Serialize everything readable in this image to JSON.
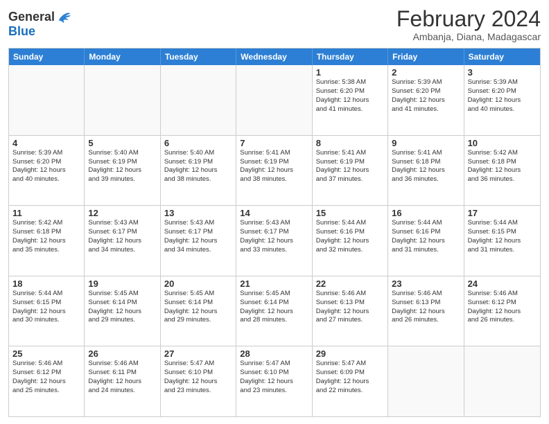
{
  "logo": {
    "general": "General",
    "blue": "Blue"
  },
  "title": {
    "main": "February 2024",
    "sub": "Ambanja, Diana, Madagascar"
  },
  "header_days": [
    "Sunday",
    "Monday",
    "Tuesday",
    "Wednesday",
    "Thursday",
    "Friday",
    "Saturday"
  ],
  "weeks": [
    [
      {
        "day": "",
        "info": ""
      },
      {
        "day": "",
        "info": ""
      },
      {
        "day": "",
        "info": ""
      },
      {
        "day": "",
        "info": ""
      },
      {
        "day": "1",
        "info": "Sunrise: 5:38 AM\nSunset: 6:20 PM\nDaylight: 12 hours\nand 41 minutes."
      },
      {
        "day": "2",
        "info": "Sunrise: 5:39 AM\nSunset: 6:20 PM\nDaylight: 12 hours\nand 41 minutes."
      },
      {
        "day": "3",
        "info": "Sunrise: 5:39 AM\nSunset: 6:20 PM\nDaylight: 12 hours\nand 40 minutes."
      }
    ],
    [
      {
        "day": "4",
        "info": "Sunrise: 5:39 AM\nSunset: 6:20 PM\nDaylight: 12 hours\nand 40 minutes."
      },
      {
        "day": "5",
        "info": "Sunrise: 5:40 AM\nSunset: 6:19 PM\nDaylight: 12 hours\nand 39 minutes."
      },
      {
        "day": "6",
        "info": "Sunrise: 5:40 AM\nSunset: 6:19 PM\nDaylight: 12 hours\nand 38 minutes."
      },
      {
        "day": "7",
        "info": "Sunrise: 5:41 AM\nSunset: 6:19 PM\nDaylight: 12 hours\nand 38 minutes."
      },
      {
        "day": "8",
        "info": "Sunrise: 5:41 AM\nSunset: 6:19 PM\nDaylight: 12 hours\nand 37 minutes."
      },
      {
        "day": "9",
        "info": "Sunrise: 5:41 AM\nSunset: 6:18 PM\nDaylight: 12 hours\nand 36 minutes."
      },
      {
        "day": "10",
        "info": "Sunrise: 5:42 AM\nSunset: 6:18 PM\nDaylight: 12 hours\nand 36 minutes."
      }
    ],
    [
      {
        "day": "11",
        "info": "Sunrise: 5:42 AM\nSunset: 6:18 PM\nDaylight: 12 hours\nand 35 minutes."
      },
      {
        "day": "12",
        "info": "Sunrise: 5:43 AM\nSunset: 6:17 PM\nDaylight: 12 hours\nand 34 minutes."
      },
      {
        "day": "13",
        "info": "Sunrise: 5:43 AM\nSunset: 6:17 PM\nDaylight: 12 hours\nand 34 minutes."
      },
      {
        "day": "14",
        "info": "Sunrise: 5:43 AM\nSunset: 6:17 PM\nDaylight: 12 hours\nand 33 minutes."
      },
      {
        "day": "15",
        "info": "Sunrise: 5:44 AM\nSunset: 6:16 PM\nDaylight: 12 hours\nand 32 minutes."
      },
      {
        "day": "16",
        "info": "Sunrise: 5:44 AM\nSunset: 6:16 PM\nDaylight: 12 hours\nand 31 minutes."
      },
      {
        "day": "17",
        "info": "Sunrise: 5:44 AM\nSunset: 6:15 PM\nDaylight: 12 hours\nand 31 minutes."
      }
    ],
    [
      {
        "day": "18",
        "info": "Sunrise: 5:44 AM\nSunset: 6:15 PM\nDaylight: 12 hours\nand 30 minutes."
      },
      {
        "day": "19",
        "info": "Sunrise: 5:45 AM\nSunset: 6:14 PM\nDaylight: 12 hours\nand 29 minutes."
      },
      {
        "day": "20",
        "info": "Sunrise: 5:45 AM\nSunset: 6:14 PM\nDaylight: 12 hours\nand 29 minutes."
      },
      {
        "day": "21",
        "info": "Sunrise: 5:45 AM\nSunset: 6:14 PM\nDaylight: 12 hours\nand 28 minutes."
      },
      {
        "day": "22",
        "info": "Sunrise: 5:46 AM\nSunset: 6:13 PM\nDaylight: 12 hours\nand 27 minutes."
      },
      {
        "day": "23",
        "info": "Sunrise: 5:46 AM\nSunset: 6:13 PM\nDaylight: 12 hours\nand 26 minutes."
      },
      {
        "day": "24",
        "info": "Sunrise: 5:46 AM\nSunset: 6:12 PM\nDaylight: 12 hours\nand 26 minutes."
      }
    ],
    [
      {
        "day": "25",
        "info": "Sunrise: 5:46 AM\nSunset: 6:12 PM\nDaylight: 12 hours\nand 25 minutes."
      },
      {
        "day": "26",
        "info": "Sunrise: 5:46 AM\nSunset: 6:11 PM\nDaylight: 12 hours\nand 24 minutes."
      },
      {
        "day": "27",
        "info": "Sunrise: 5:47 AM\nSunset: 6:10 PM\nDaylight: 12 hours\nand 23 minutes."
      },
      {
        "day": "28",
        "info": "Sunrise: 5:47 AM\nSunset: 6:10 PM\nDaylight: 12 hours\nand 23 minutes."
      },
      {
        "day": "29",
        "info": "Sunrise: 5:47 AM\nSunset: 6:09 PM\nDaylight: 12 hours\nand 22 minutes."
      },
      {
        "day": "",
        "info": ""
      },
      {
        "day": "",
        "info": ""
      }
    ]
  ]
}
